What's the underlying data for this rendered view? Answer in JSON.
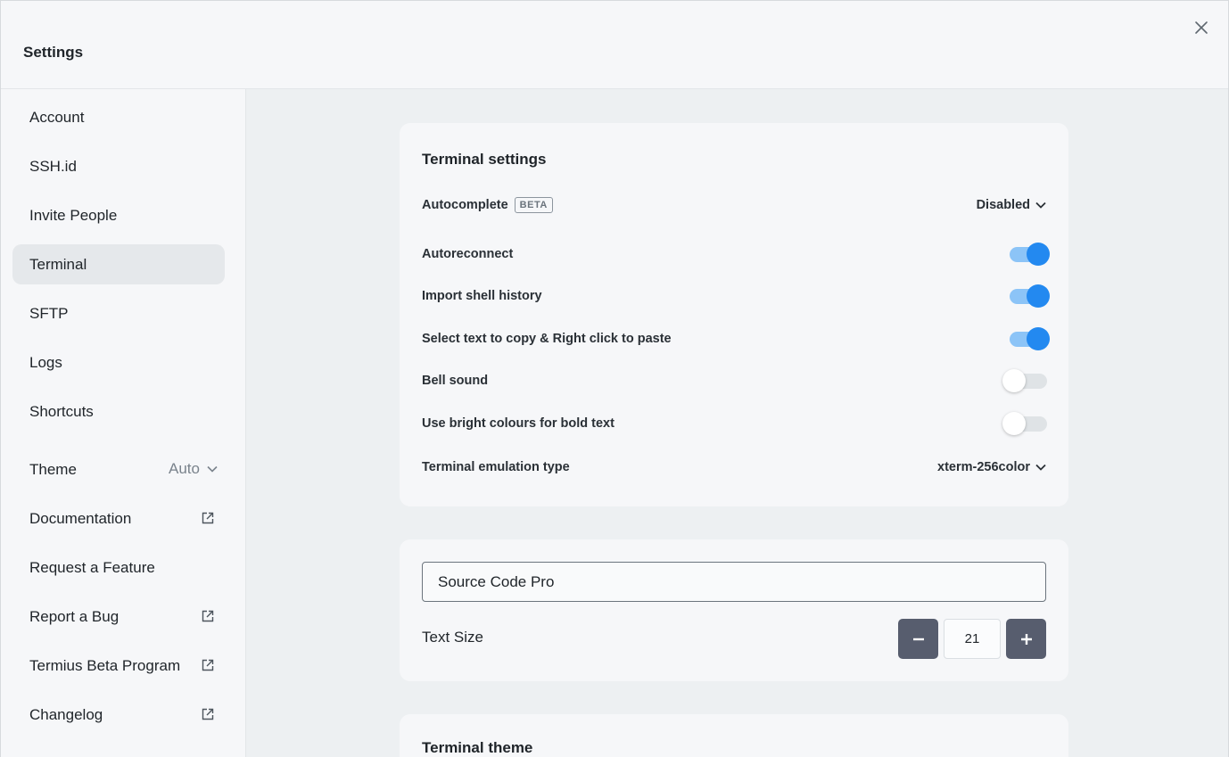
{
  "header": {
    "title": "Settings"
  },
  "sidebar": {
    "items": [
      {
        "label": "Account"
      },
      {
        "label": "SSH.id"
      },
      {
        "label": "Invite People"
      },
      {
        "label": "Terminal"
      },
      {
        "label": "SFTP"
      },
      {
        "label": "Logs"
      },
      {
        "label": "Shortcuts"
      },
      {
        "label": "Theme",
        "value": "Auto"
      },
      {
        "label": "Documentation"
      },
      {
        "label": "Request a Feature"
      },
      {
        "label": "Report a Bug"
      },
      {
        "label": "Termius Beta Program"
      },
      {
        "label": "Changelog"
      }
    ],
    "active": "Terminal"
  },
  "terminal_settings": {
    "title": "Terminal settings",
    "autocomplete": {
      "label": "Autocomplete",
      "badge": "BETA",
      "value": "Disabled"
    },
    "autoreconnect": {
      "label": "Autoreconnect",
      "on": true
    },
    "import_history": {
      "label": "Import shell history",
      "on": true
    },
    "select_copy": {
      "label": "Select text to copy & Right click to paste",
      "on": true
    },
    "bell": {
      "label": "Bell sound",
      "on": false
    },
    "bright_bold": {
      "label": "Use bright colours for bold text",
      "on": false
    },
    "emulation": {
      "label": "Terminal emulation type",
      "value": "xterm-256color"
    }
  },
  "font_settings": {
    "font": "Source Code Pro",
    "text_size_label": "Text Size",
    "text_size": "21"
  },
  "terminal_theme": {
    "title": "Terminal theme"
  },
  "colors": {
    "accent": "#2389f0",
    "accent_track": "#8cc4f7",
    "stepper": "#575d6e",
    "active_nav": "#e5e8eb"
  }
}
